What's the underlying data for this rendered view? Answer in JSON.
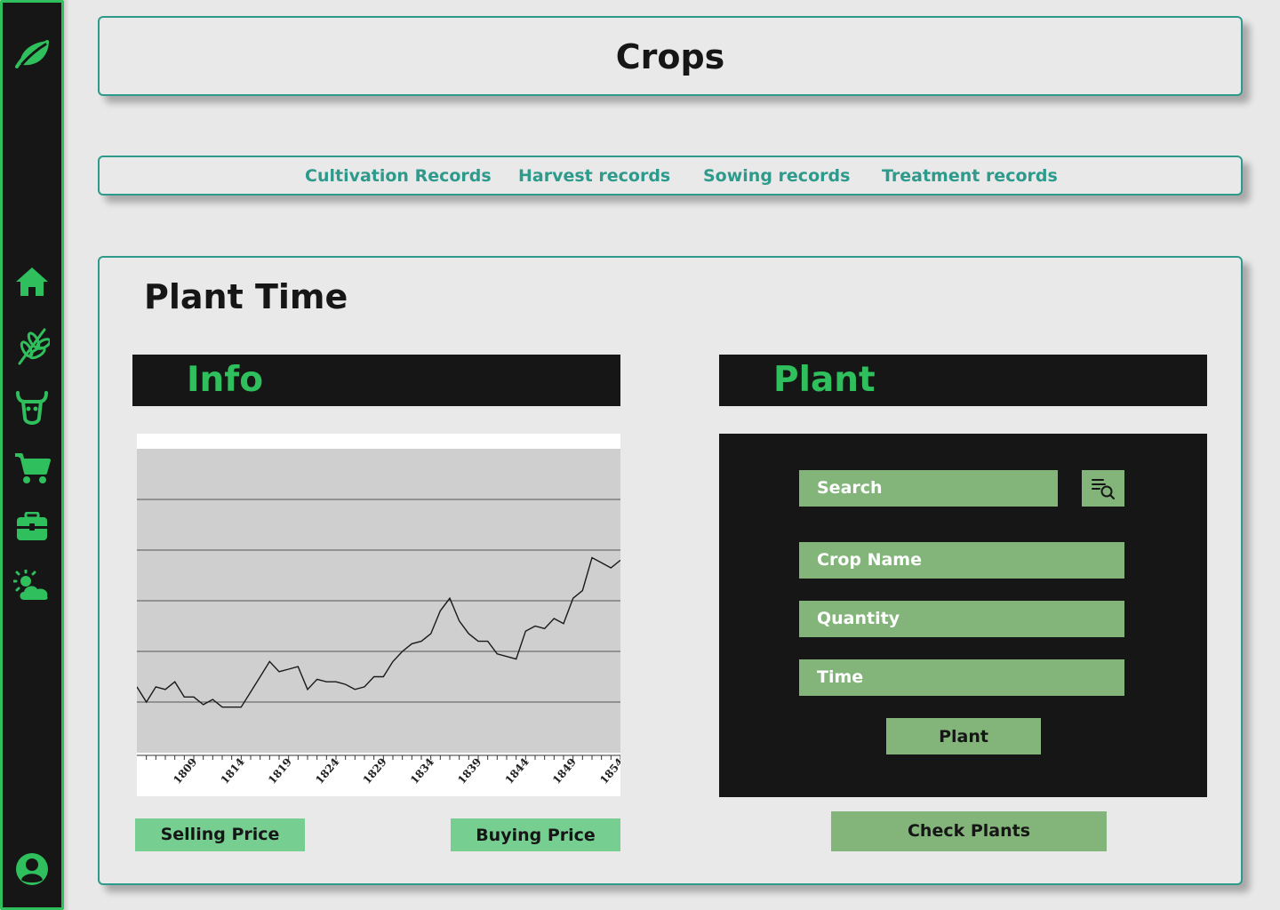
{
  "app": {
    "accent": "#2fbf5c",
    "teal": "#2e9a8c",
    "field_color": "#83b57a"
  },
  "sidebar": {
    "logo_icon": "leaf-icon",
    "items": [
      {
        "name": "home",
        "icon": "home-icon"
      },
      {
        "name": "crops",
        "icon": "wheat-icon"
      },
      {
        "name": "livestock",
        "icon": "cow-icon"
      },
      {
        "name": "market",
        "icon": "cart-icon"
      },
      {
        "name": "storage",
        "icon": "toolbox-icon"
      },
      {
        "name": "weather",
        "icon": "sun-cloud-icon"
      }
    ],
    "profile_icon": "user-circle-icon"
  },
  "header": {
    "title": "Crops"
  },
  "tabs": [
    {
      "label": "Cultivation Records"
    },
    {
      "label": "Harvest records"
    },
    {
      "label": "Sowing records"
    },
    {
      "label": "Treatment records"
    }
  ],
  "main": {
    "title": "Plant Time",
    "info": {
      "header": "Info",
      "selling_label": "Selling Price",
      "buying_label": "Buying Price"
    },
    "plant": {
      "header": "Plant",
      "search_placeholder": "Search",
      "crop_name_placeholder": "Crop Name",
      "quantity_placeholder": "Quantity",
      "time_placeholder": "Time",
      "plant_button": "Plant",
      "check_button": "Check Plants"
    }
  },
  "chart_data": {
    "type": "line",
    "title": "",
    "xlabel": "",
    "ylabel": "",
    "grid": true,
    "x_tick_labels": [
      "1809",
      "1814",
      "1819",
      "1824",
      "1829",
      "1834",
      "1839",
      "1844",
      "1849",
      "1854"
    ],
    "xlim": [
      1805,
      1856
    ],
    "ylim": [
      0,
      6
    ],
    "series": [
      {
        "x": [
          1805,
          1806,
          1807,
          1808,
          1809,
          1810,
          1811,
          1812,
          1813,
          1814,
          1815,
          1816,
          1817,
          1818,
          1819,
          1820,
          1821,
          1822,
          1823,
          1824,
          1825,
          1826,
          1827,
          1828,
          1829,
          1830,
          1831,
          1832,
          1833,
          1834,
          1835,
          1836,
          1837,
          1838,
          1839,
          1840,
          1841,
          1842,
          1843,
          1844,
          1845,
          1846,
          1847,
          1848,
          1849,
          1850,
          1851,
          1852,
          1853,
          1854,
          1855,
          1856
        ],
        "values": [
          1.3,
          1.0,
          1.3,
          1.25,
          1.4,
          1.1,
          1.1,
          0.95,
          1.05,
          0.9,
          0.9,
          0.9,
          1.2,
          1.5,
          1.8,
          1.6,
          1.65,
          1.7,
          1.25,
          1.45,
          1.4,
          1.4,
          1.35,
          1.25,
          1.3,
          1.5,
          1.5,
          1.8,
          2.0,
          2.15,
          2.2,
          2.35,
          2.8,
          3.05,
          2.6,
          2.35,
          2.2,
          2.2,
          1.95,
          1.9,
          1.85,
          2.4,
          2.5,
          2.45,
          2.65,
          2.55,
          3.05,
          3.2,
          3.85,
          3.75,
          3.65,
          3.8
        ]
      }
    ]
  }
}
